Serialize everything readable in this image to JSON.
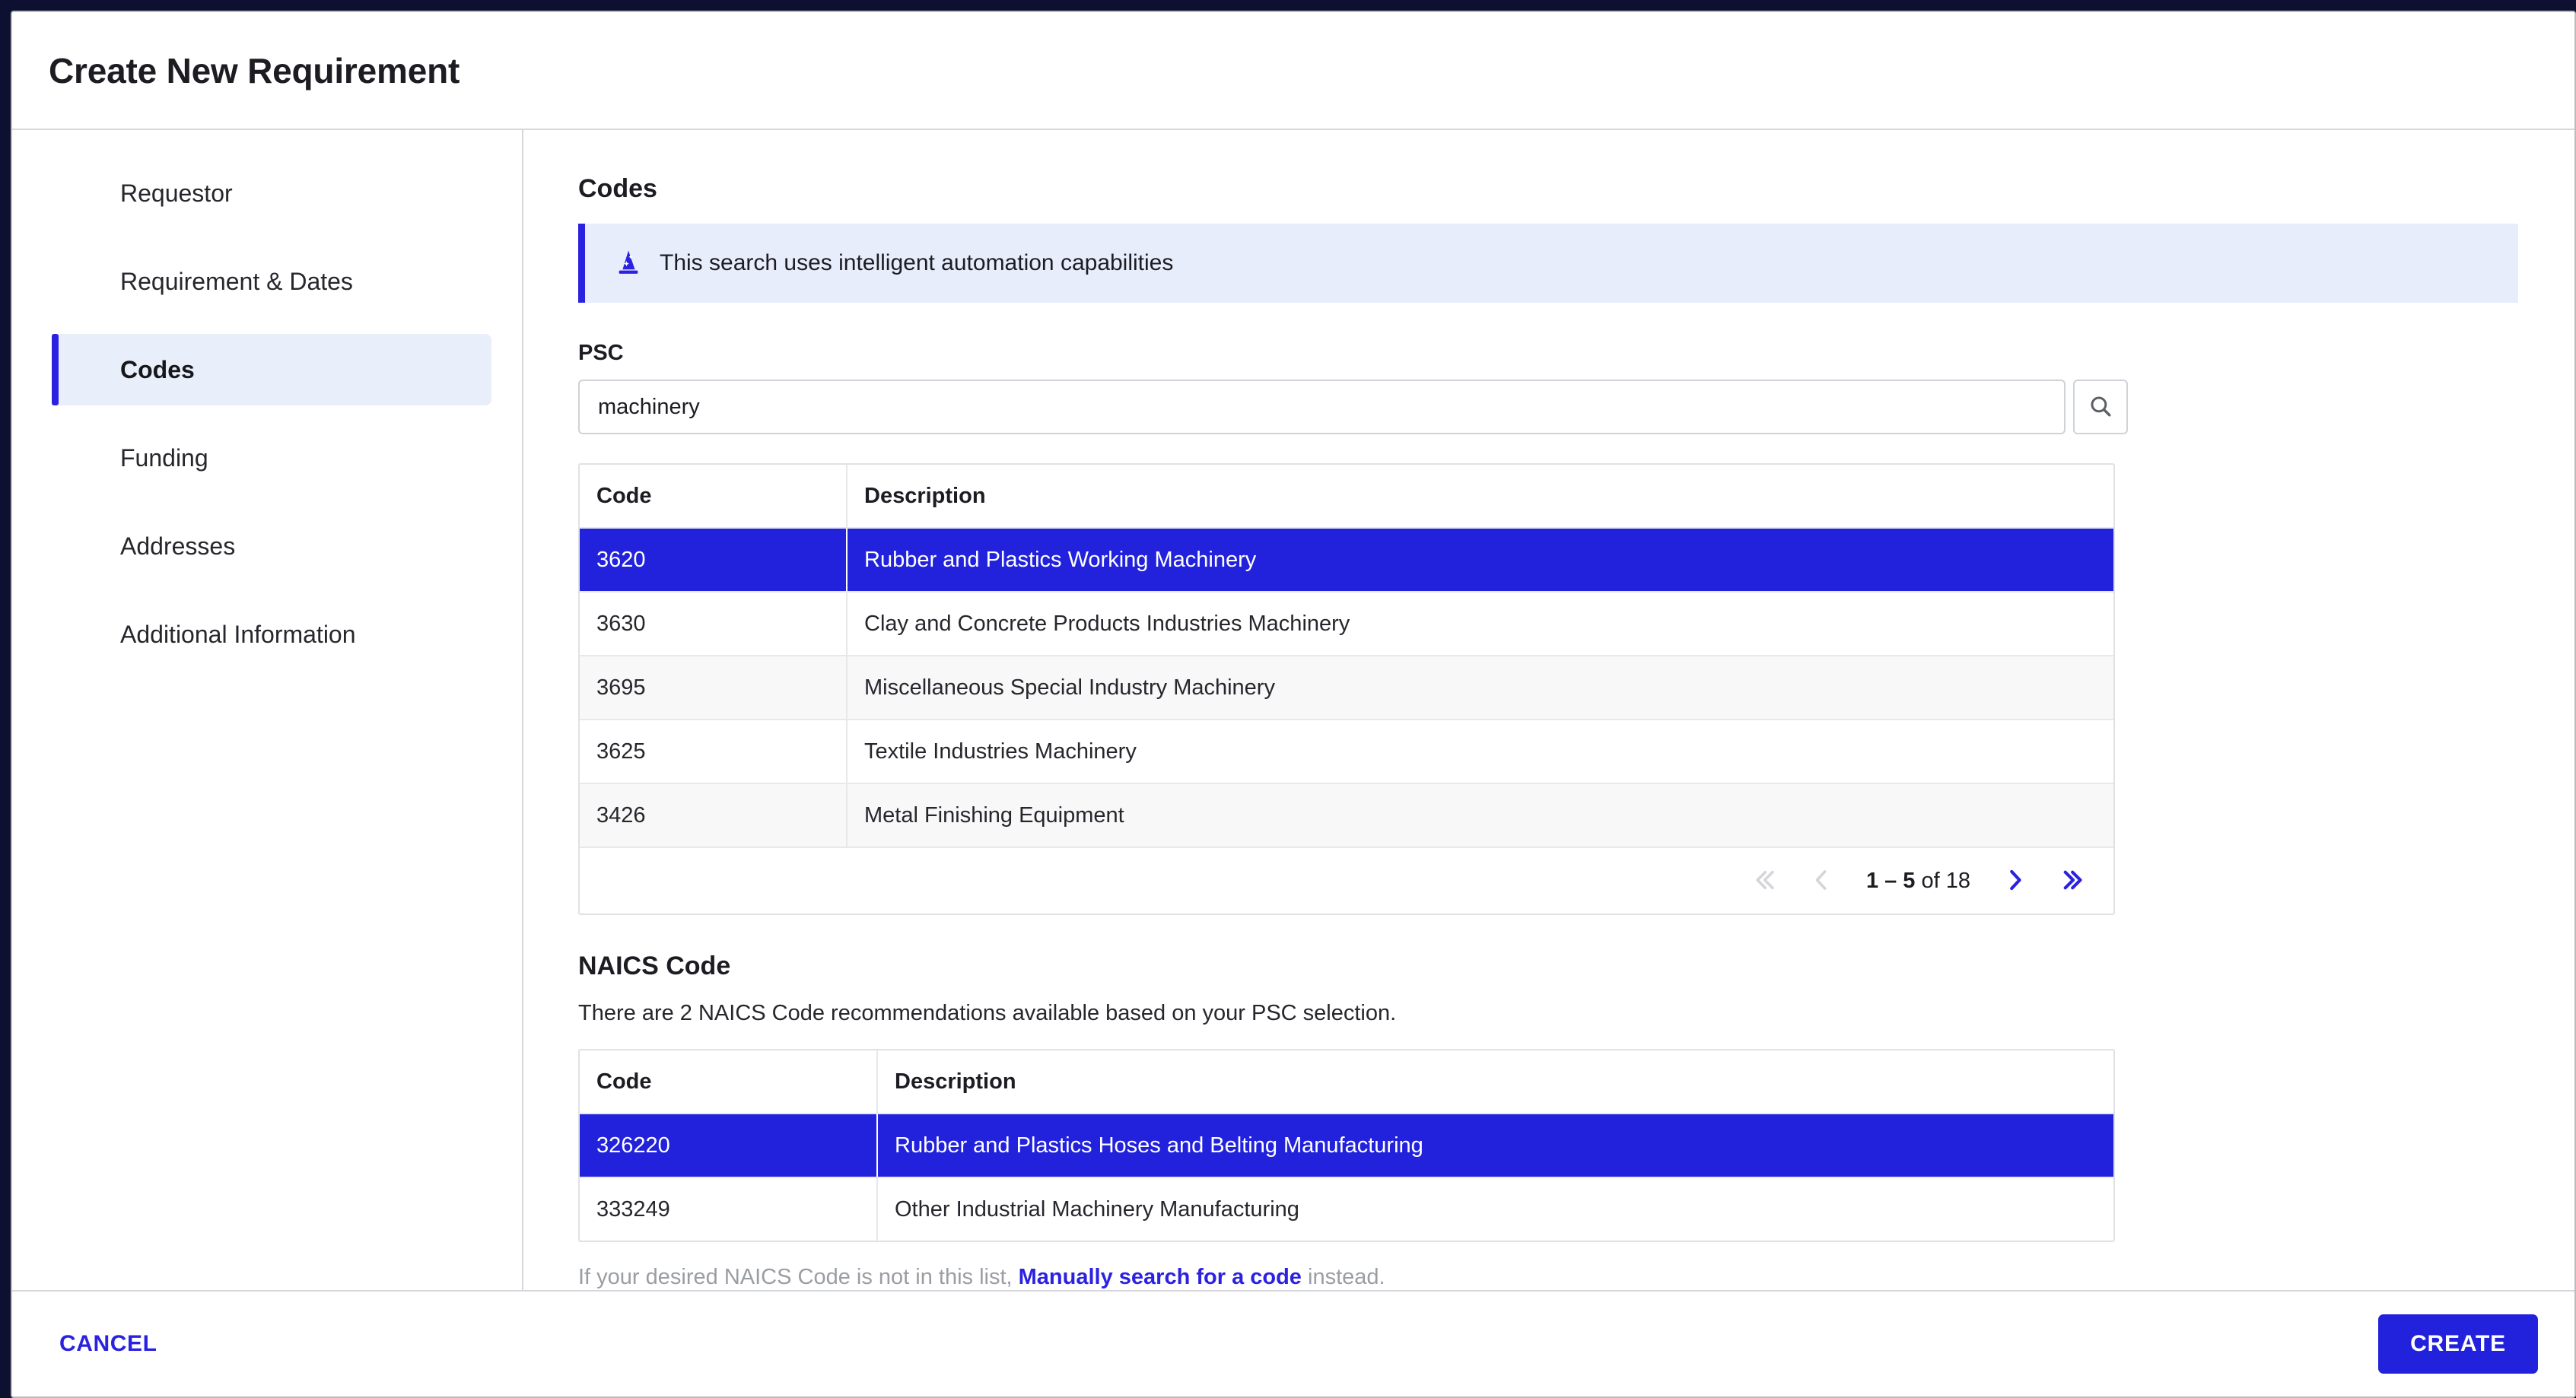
{
  "modal": {
    "title": "Create New Requirement"
  },
  "sidebar": {
    "items": [
      {
        "label": "Requestor",
        "active": false
      },
      {
        "label": "Requirement & Dates",
        "active": false
      },
      {
        "label": "Codes",
        "active": true
      },
      {
        "label": "Funding",
        "active": false
      },
      {
        "label": "Addresses",
        "active": false
      },
      {
        "label": "Additional Information",
        "active": false
      }
    ]
  },
  "content": {
    "section_title": "Codes",
    "banner": {
      "icon": "wizard-hat-icon",
      "text": "This search uses intelligent automation capabilities"
    },
    "psc": {
      "label": "PSC",
      "search_value": "machinery",
      "search_placeholder": "",
      "search_icon": "search-icon",
      "columns": [
        "Code",
        "Description"
      ],
      "rows": [
        {
          "code": "3620",
          "description": "Rubber and Plastics Working Machinery",
          "selected": true
        },
        {
          "code": "3630",
          "description": "Clay and Concrete Products Industries Machinery",
          "selected": false
        },
        {
          "code": "3695",
          "description": "Miscellaneous Special Industry Machinery",
          "selected": false
        },
        {
          "code": "3625",
          "description": "Textile Industries Machinery",
          "selected": false
        },
        {
          "code": "3426",
          "description": "Metal Finishing Equipment",
          "selected": false
        }
      ],
      "pagination": {
        "range_bold": "1 – 5",
        "range_rest": " of 18",
        "first_enabled": false,
        "prev_enabled": false,
        "next_enabled": true,
        "last_enabled": true
      }
    },
    "naics": {
      "label": "NAICS Code",
      "note": "There are 2 NAICS Code recommendations available based on your PSC selection.",
      "columns": [
        "Code",
        "Description"
      ],
      "rows": [
        {
          "code": "326220",
          "description": "Rubber and Plastics Hoses and Belting Manufacturing",
          "selected": true
        },
        {
          "code": "333249",
          "description": "Other Industrial Machinery Manufacturing",
          "selected": false
        }
      ],
      "footer_prefix": "If your desired NAICS Code is not in this list, ",
      "footer_link": "Manually search for a code",
      "footer_suffix": " instead."
    }
  },
  "footer": {
    "cancel_label": "CANCEL",
    "create_label": "CREATE"
  },
  "colors": {
    "accent": "#2222dd",
    "accent_bar": "#2b22e0",
    "banner_bg": "#e8edfc",
    "nav_active_bg": "#e8eefa",
    "stripe": "#f8f8f9",
    "disabled_arrow": "#d4d6d9"
  }
}
